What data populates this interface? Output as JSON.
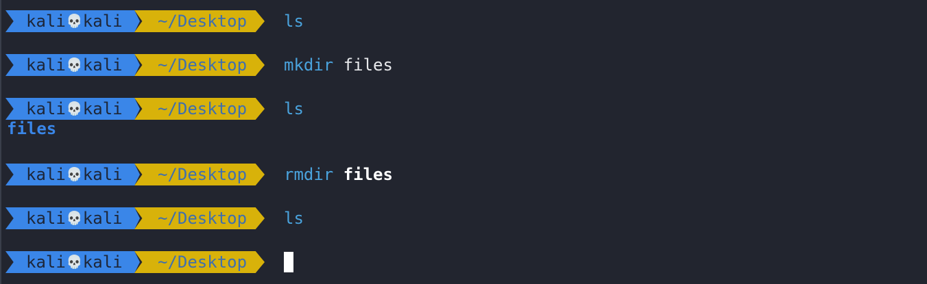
{
  "prompt": {
    "user": "kali",
    "separator_icon": "skull-icon",
    "separator_glyph": "💀",
    "host": "kali",
    "path": "~/Desktop"
  },
  "lines": [
    {
      "command": "ls",
      "args": ""
    },
    {
      "command": "mkdir",
      "args": "files"
    },
    {
      "command": "ls",
      "args": "",
      "output": "files"
    },
    {
      "command": "rmdir",
      "args": "files"
    },
    {
      "command": "ls",
      "args": ""
    },
    {
      "command": "",
      "args": ""
    }
  ],
  "colors": {
    "background": "#22252f",
    "user_segment": "#3a86e8",
    "path_segment": "#d8b20a",
    "command": "#4aa3dd",
    "argument": "#e8e9ec",
    "directory_output": "#3a86e8"
  }
}
